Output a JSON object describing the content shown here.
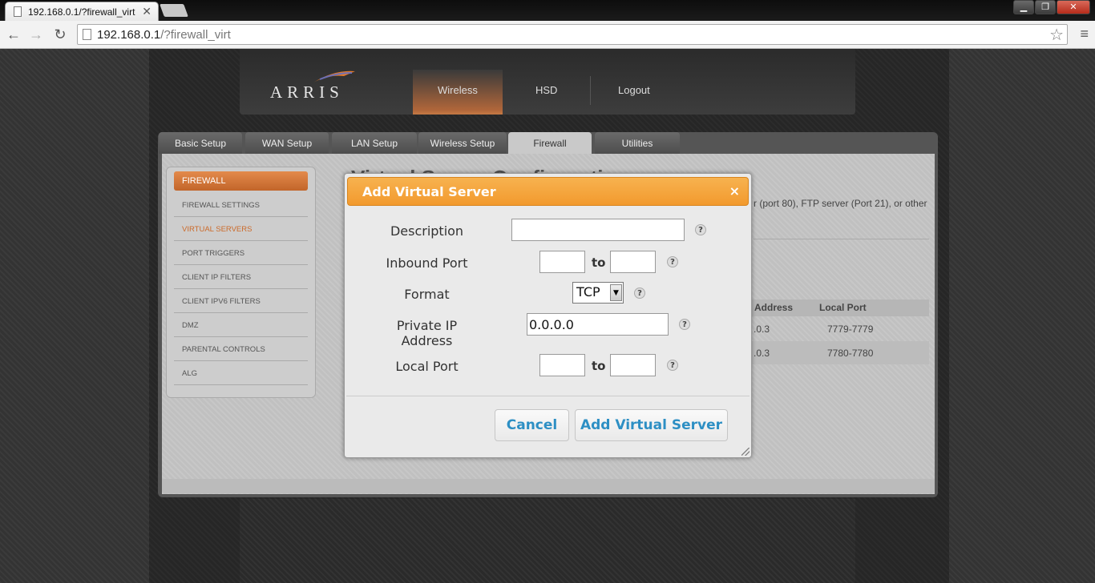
{
  "browser": {
    "tab_title": "192.168.0.1/?firewall_virt",
    "tab_close": "✕",
    "url_host": "192.168.0.1",
    "url_path": "/?firewall_virt",
    "back": "←",
    "forward": "→",
    "reload": "↻",
    "star": "☆",
    "menu": "≡",
    "window_buttons": [
      "▁",
      "❐",
      "✕"
    ]
  },
  "header": {
    "logo": "ARRIS",
    "nav": [
      "Wireless",
      "HSD",
      "Logout"
    ]
  },
  "tabs": [
    "Basic Setup",
    "WAN Setup",
    "LAN Setup",
    "Wireless Setup",
    "Firewall",
    "Utilities"
  ],
  "sidebar": {
    "heading": "FIREWALL",
    "items": [
      "FIREWALL SETTINGS",
      "VIRTUAL SERVERS",
      "PORT TRIGGERS",
      "CLIENT IP FILTERS",
      "CLIENT IPV6 FILTERS",
      "DMZ",
      "PARENTAL CONTROLS",
      "ALG"
    ]
  },
  "background": {
    "title": "Virtual Server Configuration",
    "desc": "r (port 80), FTP server (Port 21), or other",
    "table_headers": [
      "Address",
      "Local Port"
    ],
    "rows": [
      {
        "address": ".0.3",
        "local_port": "7779-7779"
      },
      {
        "address": ".0.3",
        "local_port": "7780-7780"
      }
    ]
  },
  "dialog": {
    "title": "Add Virtual Server",
    "close": "×",
    "description_label": "Description",
    "description_value": "",
    "inbound_label": "Inbound Port",
    "inbound_from": "",
    "inbound_to": "",
    "to_label": "to",
    "format_label": "Format",
    "format_value": "TCP",
    "private_ip_label_1": "Private IP",
    "private_ip_label_2": "Address",
    "private_ip_value": "0.0.0.0",
    "local_port_label": "Local Port",
    "local_from": "",
    "local_to": "",
    "help": "?",
    "cancel": "Cancel",
    "submit": "Add Virtual Server"
  },
  "colors": {
    "accent_orange": "#f29a2e",
    "button_text": "#2d8fc4",
    "sidebar_active": "#cc6a2a"
  }
}
